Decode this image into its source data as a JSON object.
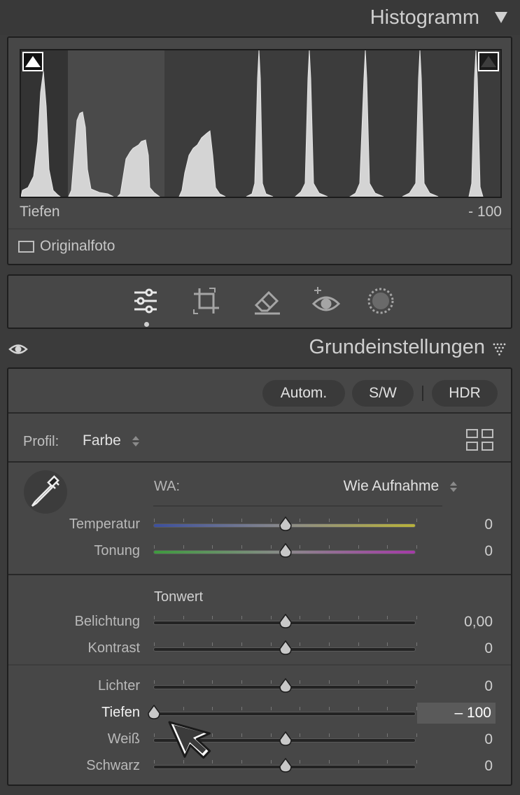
{
  "histogram": {
    "title": "Histogramm",
    "info_label": "Tiefen",
    "info_value": "- 100",
    "original_photo_label": "Originalfoto",
    "original_photo_checked": false
  },
  "tools": {
    "items": [
      {
        "name": "edit-sliders-icon",
        "active": true
      },
      {
        "name": "crop-icon",
        "active": false
      },
      {
        "name": "healing-eraser-icon",
        "active": false
      },
      {
        "name": "redeye-icon",
        "active": false
      },
      {
        "name": "masking-icon",
        "active": false
      }
    ]
  },
  "basic": {
    "title": "Grundeinstellungen",
    "buttons": {
      "auto": "Autom.",
      "bw": "S/W",
      "hdr": "HDR"
    },
    "profile_label": "Profil:",
    "profile_value": "Farbe",
    "wb_label": "WA:",
    "wb_value": "Wie Aufnahme",
    "tone_heading": "Tonwert",
    "sliders": [
      {
        "label": "Temperatur",
        "value": "0",
        "position": 0.5,
        "track": "temp"
      },
      {
        "label": "Tonung",
        "value": "0",
        "position": 0.5,
        "track": "tint"
      },
      {
        "label": "Belichtung",
        "value": "0,00",
        "position": 0.5,
        "track": "plain"
      },
      {
        "label": "Kontrast",
        "value": "0",
        "position": 0.5,
        "track": "plain"
      },
      {
        "label": "Lichter",
        "value": "0",
        "position": 0.5,
        "track": "plain"
      },
      {
        "label": "Tiefen",
        "value": "– 100",
        "position": 0.0,
        "track": "plain",
        "active": true
      },
      {
        "label": "Weiß",
        "value": "0",
        "position": 0.5,
        "track": "plain"
      },
      {
        "label": "Schwarz",
        "value": "0",
        "position": 0.5,
        "track": "plain"
      }
    ]
  },
  "colors": {
    "panel": "#474747",
    "background": "#3b3b3b",
    "text": "#d8d8d8"
  }
}
